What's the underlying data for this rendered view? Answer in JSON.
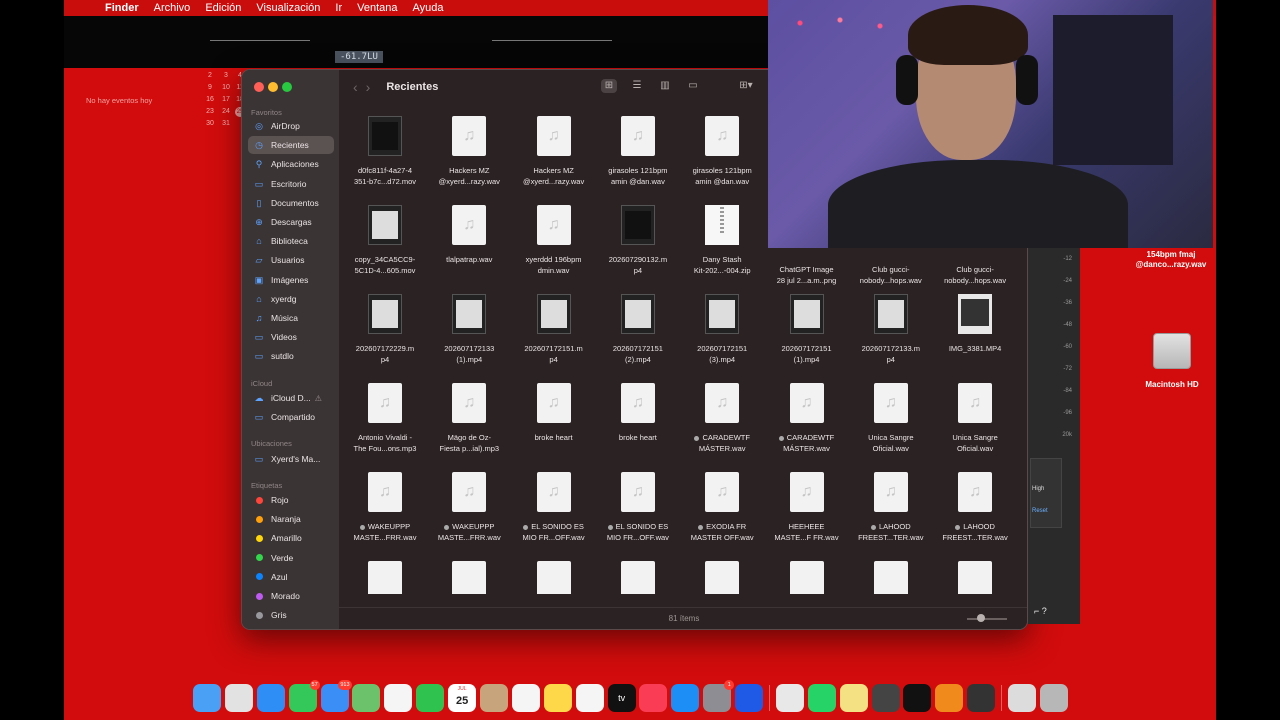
{
  "menubar": {
    "apple": "",
    "items": [
      "Finder",
      "Archivo",
      "Edición",
      "Visualización",
      "Ir",
      "Ventana",
      "Ayuda"
    ]
  },
  "audio": {
    "lufs": "-61.7LU"
  },
  "calendar_widget": {
    "no_events": "No hay eventos hoy",
    "days": [
      "2",
      "3",
      "4",
      "9",
      "10",
      "11",
      "16",
      "17",
      "18",
      "23",
      "24",
      "25",
      "30",
      "31",
      ""
    ],
    "today": "25"
  },
  "finder": {
    "title": "Recientes",
    "sidebar": {
      "sections": {
        "favorites": "Favoritos",
        "icloud": "iCloud",
        "locations": "Ubicaciones",
        "tags": "Etiquetas"
      },
      "favorites": [
        {
          "label": "AirDrop",
          "icon": "airdrop-icon",
          "glyph": "◎"
        },
        {
          "label": "Recientes",
          "icon": "clock-icon",
          "glyph": "◷"
        },
        {
          "label": "Aplicaciones",
          "icon": "applications-icon",
          "glyph": "⚲"
        },
        {
          "label": "Escritorio",
          "icon": "desktop-icon",
          "glyph": "▭"
        },
        {
          "label": "Documentos",
          "icon": "document-icon",
          "glyph": "▯"
        },
        {
          "label": "Descargas",
          "icon": "download-icon",
          "glyph": "⊕"
        },
        {
          "label": "Biblioteca",
          "icon": "library-icon",
          "glyph": "⌂"
        },
        {
          "label": "Usuarios",
          "icon": "users-icon",
          "glyph": "▱"
        },
        {
          "label": "Imágenes",
          "icon": "photos-icon",
          "glyph": "▣"
        },
        {
          "label": "xyerdg",
          "icon": "home-icon",
          "glyph": "⌂"
        },
        {
          "label": "Música",
          "icon": "music-icon",
          "glyph": "♫"
        },
        {
          "label": "Videos",
          "icon": "video-icon",
          "glyph": "▭"
        },
        {
          "label": "sutdlo",
          "icon": "folder-icon",
          "glyph": "▭"
        }
      ],
      "icloud": [
        {
          "label": "iCloud D...",
          "icon": "icloud-icon",
          "glyph": "☁",
          "warning": "⚠"
        },
        {
          "label": "Compartido",
          "icon": "shared-folder-icon",
          "glyph": "▭"
        }
      ],
      "locations": [
        {
          "label": "Xyerd's Ma...",
          "icon": "laptop-icon",
          "glyph": "▭"
        }
      ],
      "tags": [
        {
          "label": "Rojo",
          "color": "#ff453a"
        },
        {
          "label": "Naranja",
          "color": "#ff9f0a"
        },
        {
          "label": "Amarillo",
          "color": "#ffd60a"
        },
        {
          "label": "Verde",
          "color": "#32d74b"
        },
        {
          "label": "Azul",
          "color": "#0a84ff"
        },
        {
          "label": "Morado",
          "color": "#bf5af2"
        },
        {
          "label": "Gris",
          "color": "#98989d"
        }
      ]
    },
    "files": [
      {
        "name": "d0fc811f-4a27-4\n351-b7c...d72.mov",
        "kind": "vid-dark"
      },
      {
        "name": "Hackers MZ\n@xyerd...razy.wav",
        "kind": "doc"
      },
      {
        "name": "Hackers MZ\n@xyerd...razy.wav",
        "kind": "doc"
      },
      {
        "name": "girasoles 121bpm\namin @dan.wav",
        "kind": "doc"
      },
      {
        "name": "girasoles 121bpm\namin @dan.wav",
        "kind": "doc"
      },
      {
        "name": "",
        "kind": "none"
      },
      {
        "name": "",
        "kind": "none"
      },
      {
        "name": "",
        "kind": "none"
      },
      {
        "name": "copy_34CA5CC9-\n5C1D-4...605.mov",
        "kind": "vid"
      },
      {
        "name": "tlalpatrap.wav",
        "kind": "doc"
      },
      {
        "name": "xyerddd 196bpm\ndmin.wav",
        "kind": "doc"
      },
      {
        "name": "202607290132.m\np4",
        "kind": "vid-dark"
      },
      {
        "name": "Dany Stash\nKit-202...-004.zip",
        "kind": "zip"
      },
      {
        "name": "ChatGPT Image\n28 jul 2...a.m..png",
        "kind": "none"
      },
      {
        "name": "Club gucci-\nnobody...hops.wav",
        "kind": "none"
      },
      {
        "name": "Club gucci-\nnobody...hops.wav",
        "kind": "none"
      },
      {
        "name": "202607172229.m\np4",
        "kind": "vid"
      },
      {
        "name": "202607172133\n(1).mp4",
        "kind": "vid"
      },
      {
        "name": "202607172151.m\np4",
        "kind": "vid"
      },
      {
        "name": "202607172151\n(2).mp4",
        "kind": "vid"
      },
      {
        "name": "202607172151\n(3).mp4",
        "kind": "vid"
      },
      {
        "name": "202607172151\n(1).mp4",
        "kind": "vid"
      },
      {
        "name": "202607172133.m\np4",
        "kind": "vid"
      },
      {
        "name": "IMG_3381.MP4",
        "kind": "img"
      },
      {
        "name": "Antonio Vivaldi -\nThe Fou...ons.mp3",
        "kind": "doc"
      },
      {
        "name": "Mägo de Oz-\nFiesta p...ial).mp3",
        "kind": "doc"
      },
      {
        "name": "broke heart",
        "kind": "doc"
      },
      {
        "name": "broke heart",
        "kind": "doc"
      },
      {
        "name": "CARADEWTF\nMÁSTER.wav",
        "kind": "doc",
        "tag": true
      },
      {
        "name": "CARADEWTF\nMÁSTER.wav",
        "kind": "doc",
        "tag": true
      },
      {
        "name": "Unica Sangre\nOficial.wav",
        "kind": "doc"
      },
      {
        "name": "Unica Sangre\nOficial.wav",
        "kind": "doc"
      },
      {
        "name": "WAKEUPPP\nMASTE...FRR.wav",
        "kind": "doc",
        "tag": true
      },
      {
        "name": "WAKEUPPP\nMASTE...FRR.wav",
        "kind": "doc",
        "tag": true
      },
      {
        "name": "EL SONIDO ES\nMIO FR...OFF.wav",
        "kind": "doc",
        "tag": true
      },
      {
        "name": "EL SONIDO ES\nMIO FR...OFF.wav",
        "kind": "doc",
        "tag": true
      },
      {
        "name": "EXODIA FR\nMASTER OFF.wav",
        "kind": "doc",
        "tag": true
      },
      {
        "name": "HEEHEEE\nMASTE...F FR.wav",
        "kind": "doc"
      },
      {
        "name": "LAHOOD\nFREEST...TER.wav",
        "kind": "doc",
        "tag": true
      },
      {
        "name": "LAHOOD\nFREEST...TER.wav",
        "kind": "doc",
        "tag": true
      }
    ],
    "status": "81 ítems"
  },
  "daw": {
    "ruler": [
      "-12",
      "-24",
      "-36",
      "-48",
      "-60",
      "-72",
      "-84",
      "-96",
      "20k"
    ],
    "high": "High",
    "reset": "Reset",
    "keys": "⌐ ?"
  },
  "desktop": {
    "file_label": "154bpm fmaj\n@danco...razy.wav",
    "hd_label": "Macintosh HD"
  },
  "dock": [
    {
      "icon": "finder-icon",
      "color": "#4aa0f5"
    },
    {
      "icon": "launchpad-icon",
      "color": "#e2e2e2"
    },
    {
      "icon": "safari-icon",
      "color": "#2f8ef5"
    },
    {
      "icon": "messages-icon",
      "color": "#34c759",
      "badge": "57"
    },
    {
      "icon": "mail-icon",
      "color": "#3b8ef5",
      "badge": "913"
    },
    {
      "icon": "maps-icon",
      "color": "#6cc26a"
    },
    {
      "icon": "photos-icon",
      "color": "#f5f5f5"
    },
    {
      "icon": "facetime-icon",
      "color": "#30c24f"
    },
    {
      "icon": "calendar-icon",
      "color": "#ffffff",
      "cal_month": "JUL",
      "cal_day": "25"
    },
    {
      "icon": "contacts-icon",
      "color": "#c8a47c"
    },
    {
      "icon": "reminders-icon",
      "color": "#f5f5f5"
    },
    {
      "icon": "notes-icon",
      "color": "#ffd84a"
    },
    {
      "icon": "freeform-icon",
      "color": "#f5f5f5"
    },
    {
      "icon": "apple-tv-icon",
      "color": "#111111",
      "label": "tv"
    },
    {
      "icon": "music-icon",
      "color": "#fa3c55"
    },
    {
      "icon": "app-store-icon",
      "color": "#1c8ef5"
    },
    {
      "icon": "system-settings-icon",
      "color": "#8d8d93",
      "badge": "1"
    },
    {
      "icon": "sidecar-icon",
      "color": "#1f5ae6"
    },
    {
      "icon": "separator",
      "color": ""
    },
    {
      "icon": "chrome-icon",
      "color": "#e8e8e8"
    },
    {
      "icon": "whatsapp-icon",
      "color": "#25d366"
    },
    {
      "icon": "stickies-icon",
      "color": "#f3e184"
    },
    {
      "icon": "logic-icon",
      "color": "#444444"
    },
    {
      "icon": "capcut-icon",
      "color": "#111111"
    },
    {
      "icon": "fl-studio-icon",
      "color": "#f08a1c"
    },
    {
      "icon": "instruments-icon",
      "color": "#333333"
    },
    {
      "icon": "separator",
      "color": ""
    },
    {
      "icon": "documents-stack-icon",
      "color": "#dcdcdc"
    },
    {
      "icon": "trash-icon",
      "color": "#b7b7b7"
    }
  ]
}
